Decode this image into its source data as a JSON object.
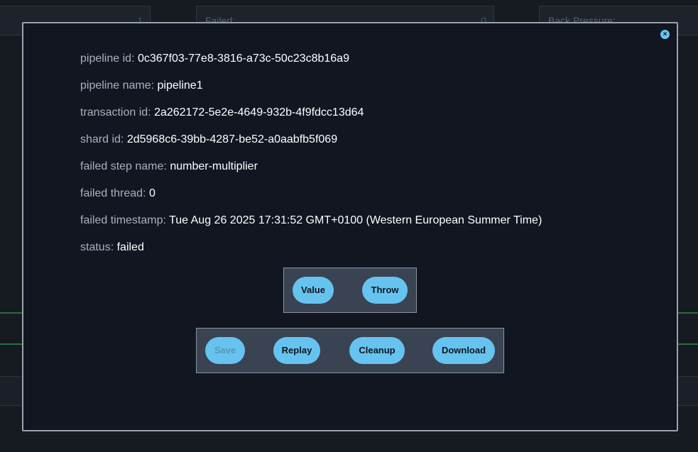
{
  "background": {
    "cards": [
      {
        "label": "",
        "value": "1"
      },
      {
        "label": "Failed:",
        "value": "0"
      },
      {
        "label": "Back Pressure:",
        "value": ""
      }
    ]
  },
  "modal": {
    "close_icon": "×",
    "fields": [
      {
        "key": "pipeline id:",
        "value": "0c367f03-77e8-3816-a73c-50c23c8b16a9"
      },
      {
        "key": "pipeline name:",
        "value": "pipeline1"
      },
      {
        "key": "transaction id:",
        "value": "2a262172-5e2e-4649-932b-4f9fdcc13d64"
      },
      {
        "key": "shard id:",
        "value": "2d5968c6-39bb-4287-be52-a0aabfb5f069"
      },
      {
        "key": "failed step name:",
        "value": "number-multiplier"
      },
      {
        "key": "failed thread:",
        "value": "0"
      },
      {
        "key": "failed timestamp:",
        "value": "Tue Aug 26 2025 17:31:52 GMT+0100 (Western European Summer Time)"
      },
      {
        "key": "status:",
        "value": "failed"
      }
    ],
    "view_buttons": {
      "value": "Value",
      "throw": "Throw"
    },
    "action_buttons": {
      "save": "Save",
      "replay": "Replay",
      "cleanup": "Cleanup",
      "download": "Download"
    }
  },
  "colors": {
    "accent": "#66c3f0",
    "modal_bg": "#111621",
    "group_bg": "#3a4352"
  }
}
